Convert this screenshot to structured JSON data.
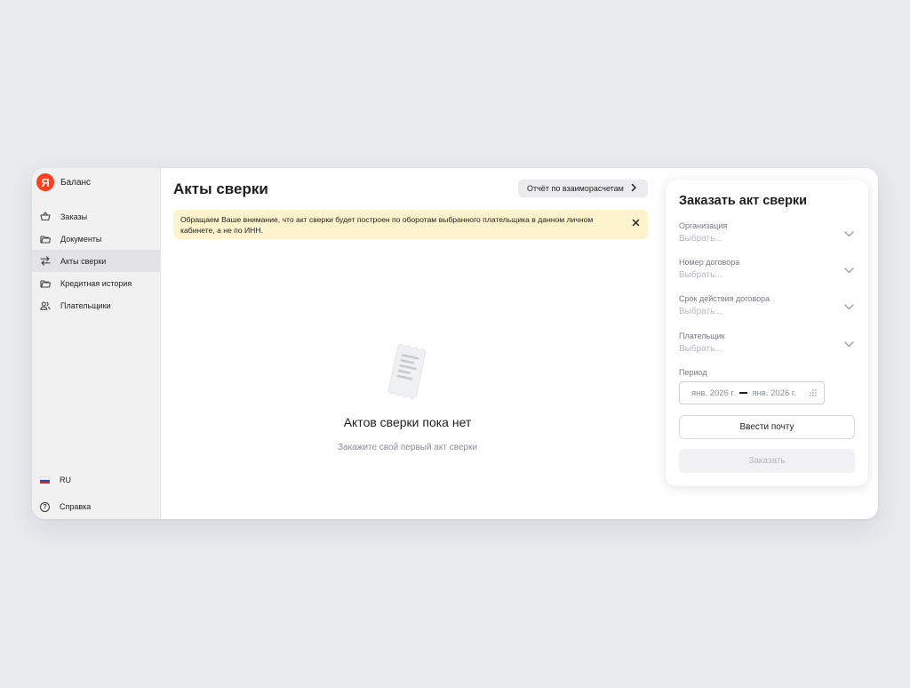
{
  "brand": {
    "logo_letter": "Я",
    "name": "Баланс"
  },
  "sidebar": {
    "items": [
      {
        "label": "Заказы",
        "icon": "basket-icon"
      },
      {
        "label": "Документы",
        "icon": "folder-icon"
      },
      {
        "label": "Акты сверки",
        "icon": "arrows-swap-icon",
        "active": true
      },
      {
        "label": "Кредитная история",
        "icon": "folder-icon"
      },
      {
        "label": "Плательщики",
        "icon": "users-icon"
      }
    ],
    "language": {
      "label": "RU",
      "icon": "russian-flag-icon"
    },
    "help": {
      "label": "Справка",
      "icon": "help-icon"
    }
  },
  "main": {
    "title": "Акты сверки",
    "report_button": "Отчёт по взаиморасчетам",
    "notice": "Обращаем Ваше внимание, что акт сверки будет построен по оборотам выбранного плательщика в данном личном кабинете, а не по ИНН.",
    "empty_title": "Актов сверки пока нет",
    "empty_subtitle": "Закажите свой первый акт сверки"
  },
  "order_panel": {
    "title": "Заказать акт сверки",
    "fields": [
      {
        "label": "Организация",
        "placeholder": "Выбрать..."
      },
      {
        "label": "Номер договора",
        "placeholder": "Выбрать..."
      },
      {
        "label": "Срок действия договора",
        "placeholder": "Выбрать..."
      },
      {
        "label": "Плательщик",
        "placeholder": "Выбрать..."
      }
    ],
    "period_label": "Период",
    "period_from": "янв. 2026 г.",
    "period_to": "янв. 2026 г.",
    "email_button": "Ввести почту",
    "order_button": "Заказать"
  },
  "colors": {
    "brand_red": "#fc3f1d",
    "notice_bg": "#fdf3cc",
    "active_nav_bg": "#e3e3e6",
    "page_bg": "#e8eaee"
  }
}
